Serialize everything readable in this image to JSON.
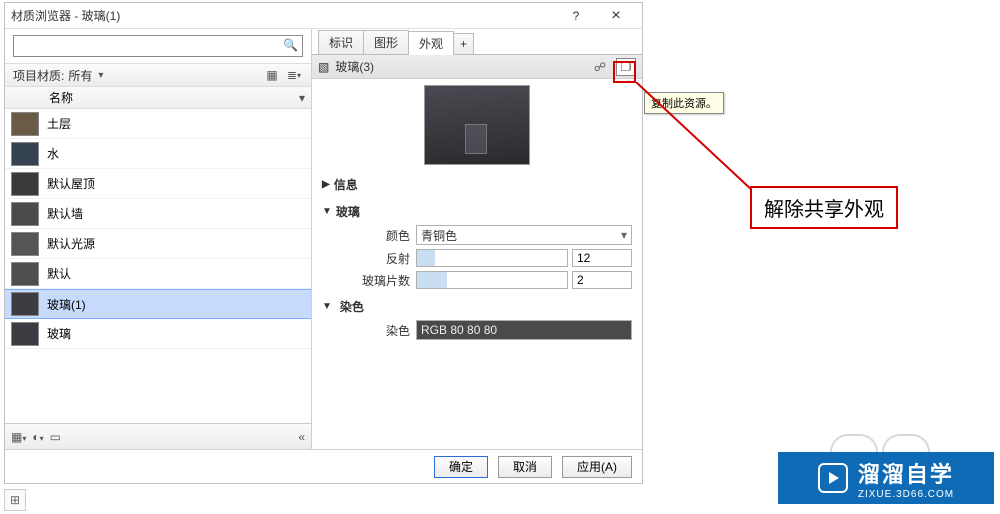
{
  "titlebar": {
    "title": "材质浏览器 - 玻璃(1)",
    "help": "?",
    "close": "×"
  },
  "leftPanel": {
    "filterLabel": "项目材质:",
    "filterValue": "所有",
    "header": "名称",
    "items": [
      {
        "name": "土层",
        "swatch": "#6a5b47"
      },
      {
        "name": "水",
        "swatch": "#35424f"
      },
      {
        "name": "默认屋顶",
        "swatch": "#3a3a3a"
      },
      {
        "name": "默认墙",
        "swatch": "#4b4b4b"
      },
      {
        "name": "默认光源",
        "swatch": "#555555"
      },
      {
        "name": "默认",
        "swatch": "#4f4f4f"
      },
      {
        "name": "玻璃(1)",
        "swatch": "#3c3c42"
      },
      {
        "name": "玻璃",
        "swatch": "#3c3c42"
      }
    ],
    "selectedIndex": 6,
    "collapse": "«"
  },
  "tabs": {
    "t0": "标识",
    "t1": "图形",
    "t2": "外观",
    "add": "+"
  },
  "assetBar": {
    "prefix": "▢",
    "name": "玻璃(3)"
  },
  "sections": {
    "info": "信息",
    "glass": "玻璃",
    "tint": "染色",
    "colorLabel": "颜色",
    "colorValue": "青铜色",
    "reflectLabel": "反射",
    "reflectValue": "12",
    "sheetsLabel": "玻璃片数",
    "sheetsValue": "2",
    "tintLabel": "染色",
    "tintValue": "RGB 80 80 80"
  },
  "footer": {
    "ok": "确定",
    "cancel": "取消",
    "apply": "应用(A)"
  },
  "tooltip": "复制此资源。",
  "callout": "解除共享外观",
  "watermark": {
    "brand": "溜溜自学",
    "url": "ZIXUE.3D66.COM"
  }
}
